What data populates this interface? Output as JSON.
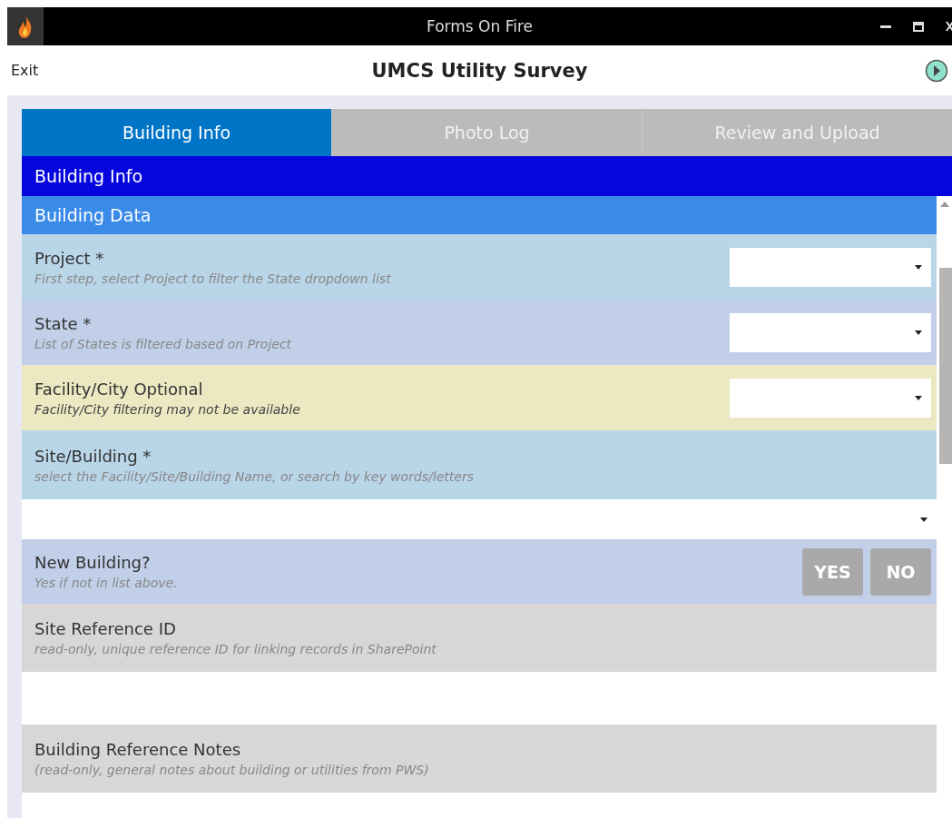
{
  "window": {
    "title": "Forms On Fire"
  },
  "header": {
    "exit": "Exit",
    "title": "UMCS Utility Survey"
  },
  "tabs": [
    {
      "label": "Building Info",
      "selected": true
    },
    {
      "label": "Photo Log",
      "selected": false
    },
    {
      "label": "Review and Upload",
      "selected": false
    }
  ],
  "page_heading": "Building Info",
  "section_heading": "Building Data",
  "fields": [
    {
      "kind": "dropdown",
      "color": "#b9d5e8",
      "label": "Project *",
      "hint": "First step, select Project to filter the State dropdown list"
    },
    {
      "kind": "dropdown",
      "color": "#c1cfe9",
      "label": "State *",
      "hint": "List of States is filtered based on Project"
    },
    {
      "kind": "dropdown",
      "color": "#ebe8c2",
      "label": "Facility/City Optional",
      "hint": "Facility/City filtering may not be available",
      "hint_strong": true
    },
    {
      "kind": "wide-dropdown",
      "color": "#b9d5e8",
      "label": "Site/Building *",
      "hint": "select the Facility/Site/Building Name, or search by key words/letters"
    },
    {
      "kind": "toggle",
      "color": "#c1cfe9",
      "label": "New Building?",
      "hint": "Yes if not in list above.",
      "options": [
        {
          "label": "YES",
          "selected": false
        },
        {
          "label": "NO",
          "selected": false
        }
      ]
    },
    {
      "kind": "readonly",
      "color": "#d9d7d6",
      "label": "Site Reference ID",
      "hint": "read-only, unique reference ID for linking records in SharePoint"
    },
    {
      "kind": "readonly",
      "color": "#d9d7d6",
      "label": "Building Reference Notes",
      "hint": "(read-only, general notes about building or utilities from PWS)"
    }
  ]
}
